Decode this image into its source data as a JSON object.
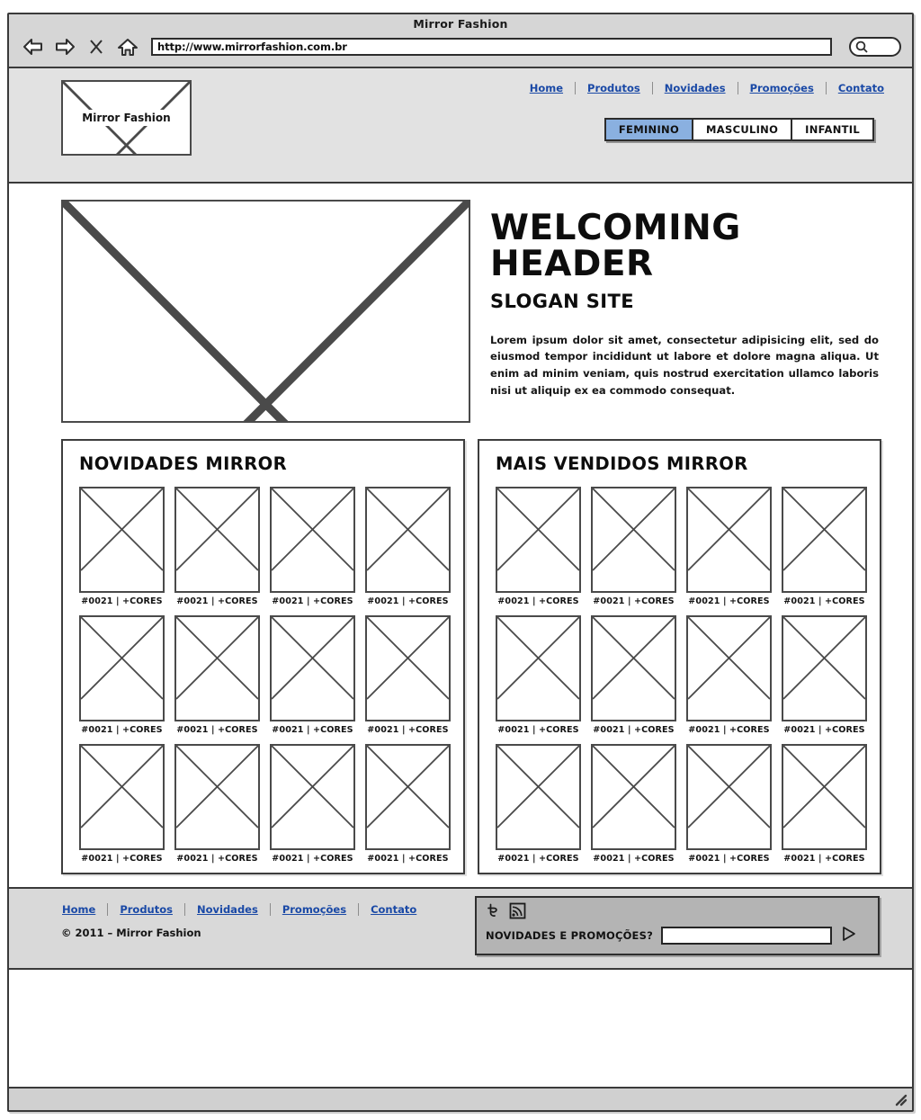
{
  "browser": {
    "window_title": "Mirror Fashion",
    "url": "http://www.mirrorfashion.com.br",
    "back_icon": "back-arrow-icon",
    "forward_icon": "forward-arrow-icon",
    "stop_icon": "close-x-icon",
    "home_icon": "home-icon",
    "search_icon": "search-icon"
  },
  "header": {
    "logo_label": "Mirror Fashion",
    "nav": [
      {
        "label": "Home"
      },
      {
        "label": "Produtos"
      },
      {
        "label": "Novidades"
      },
      {
        "label": "Promoções"
      },
      {
        "label": "Contato"
      }
    ],
    "tabs": [
      {
        "label": "FEMININO",
        "active": true
      },
      {
        "label": "MASCULINO",
        "active": false
      },
      {
        "label": "INFANTIL",
        "active": false
      }
    ],
    "accent_color": "#8ab0e0",
    "link_color": "#1a49a6"
  },
  "hero": {
    "image_placeholder": "hero-image-placeholder",
    "title": "WELCOMING HEADER",
    "slogan": "SLOGAN SITE",
    "body": "Lorem ipsum dolor sit amet, consectetur adipisicing elit, sed do eiusmod tempor incididunt ut labore et dolore magna aliqua. Ut enim ad minim veniam, quis nostrud exercitation ullamco laboris nisi ut aliquip ex ea commodo consequat."
  },
  "panels": [
    {
      "title": "NOVIDADES MIRROR",
      "products": [
        {
          "label": "#0021 | +CORES"
        },
        {
          "label": "#0021 | +CORES"
        },
        {
          "label": "#0021 | +CORES"
        },
        {
          "label": "#0021 | +CORES"
        },
        {
          "label": "#0021 | +CORES"
        },
        {
          "label": "#0021 | +CORES"
        },
        {
          "label": "#0021 | +CORES"
        },
        {
          "label": "#0021 | +CORES"
        },
        {
          "label": "#0021 | +CORES"
        },
        {
          "label": "#0021 | +CORES"
        },
        {
          "label": "#0021 | +CORES"
        },
        {
          "label": "#0021 | +CORES"
        }
      ]
    },
    {
      "title": "MAIS VENDIDOS MIRROR",
      "products": [
        {
          "label": "#0021 | +CORES"
        },
        {
          "label": "#0021 | +CORES"
        },
        {
          "label": "#0021 | +CORES"
        },
        {
          "label": "#0021 | +CORES"
        },
        {
          "label": "#0021 | +CORES"
        },
        {
          "label": "#0021 | +CORES"
        },
        {
          "label": "#0021 | +CORES"
        },
        {
          "label": "#0021 | +CORES"
        },
        {
          "label": "#0021 | +CORES"
        },
        {
          "label": "#0021 | +CORES"
        },
        {
          "label": "#0021 | +CORES"
        },
        {
          "label": "#0021 | +CORES"
        }
      ]
    }
  ],
  "footer": {
    "nav": [
      {
        "label": "Home"
      },
      {
        "label": "Produtos"
      },
      {
        "label": "Novidades"
      },
      {
        "label": "Promoções"
      },
      {
        "label": "Contato"
      }
    ],
    "copyright": "© 2011 – Mirror Fashion",
    "newsletter": {
      "twitter_icon": "twitter-icon",
      "rss_icon": "rss-icon",
      "label": "NOVIDADES E PROMOÇÕES?",
      "value": "",
      "placeholder": "",
      "submit_icon": "submit-triangle-icon"
    }
  },
  "status_bar": {
    "resize_icon": "resize-grip-icon"
  }
}
